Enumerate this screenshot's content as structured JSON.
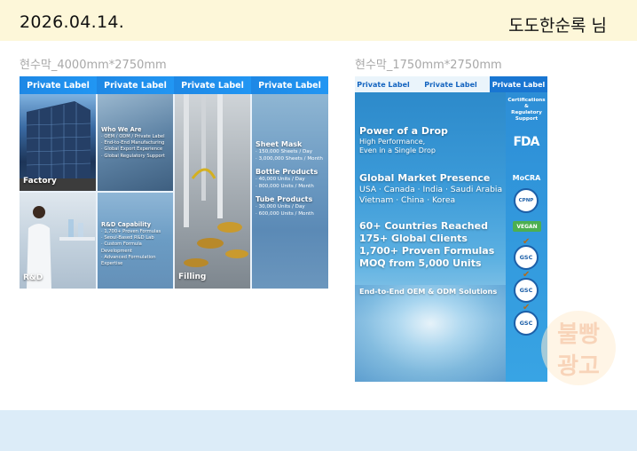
{
  "header": {
    "date": "2026.04.14.",
    "client": "도도한순록 님"
  },
  "banner1": {
    "size_label": "현수막_4000mm*2750mm",
    "tabs": [
      "Private Label",
      "Private Label",
      "Private Label",
      "Private Label"
    ],
    "factory_label": "Factory",
    "rnd_label": "R&D",
    "filling_label": "Filling",
    "who_title": "Who We Are",
    "who_items": [
      "OEM / ODM / Private Label",
      "End-to-End Manufacturing",
      "Global Export Experience",
      "Global Regulatory Support"
    ],
    "rnd_title": "R&D Capability",
    "rnd_items": [
      "1,700+ Proven Formulas",
      "Seoul-Based R&D Lab",
      "Custom Formula Development",
      "Advanced Formulation Expertise"
    ],
    "products": [
      {
        "title": "Sheet Mask",
        "lines": [
          "150,000 Sheets / Day",
          "3,000,000 Sheets / Month"
        ]
      },
      {
        "title": "Bottle Products",
        "lines": [
          "40,000 Units / Day",
          "800,000 Units / Month"
        ]
      },
      {
        "title": "Tube Products",
        "lines": [
          "30,000 Units / Day",
          "600,000 Units / Month"
        ]
      }
    ]
  },
  "banner2": {
    "size_label": "현수막_1750mm*2750mm",
    "tabs": [
      "Private Label",
      "Private Label",
      "Private Label"
    ],
    "power_title": "Power of a Drop",
    "power_sub1": "High Performance,",
    "power_sub2": "Even in a Single Drop",
    "global_title": "Global Market Presence",
    "global_line1": "USA · Canada · India · Saudi Arabia",
    "global_line2": "Vietnam · China · Korea",
    "stats": [
      "60+ Countries Reached",
      "175+ Global Clients",
      "1,700+ Proven Formulas",
      "MOQ from 5,000 Units"
    ],
    "e2e": "End-to-End OEM & ODM Solutions",
    "cert_title_1": "Certifications",
    "cert_title_2": "&",
    "cert_title_3": "Regulatory",
    "cert_title_4": "Support",
    "fda": "FDA",
    "mocra": "MoCRA",
    "cpnp": "CPNP",
    "vegan": "VEGAN",
    "gsc": [
      "GSC",
      "GSC",
      "GSC"
    ]
  },
  "watermark": {
    "line1": "불빵",
    "line2": "광고"
  },
  "colors": {
    "header_bg": "#fdf7d9",
    "footer_bg": "#dcecf8",
    "accent_blue": "#1e88e5"
  }
}
